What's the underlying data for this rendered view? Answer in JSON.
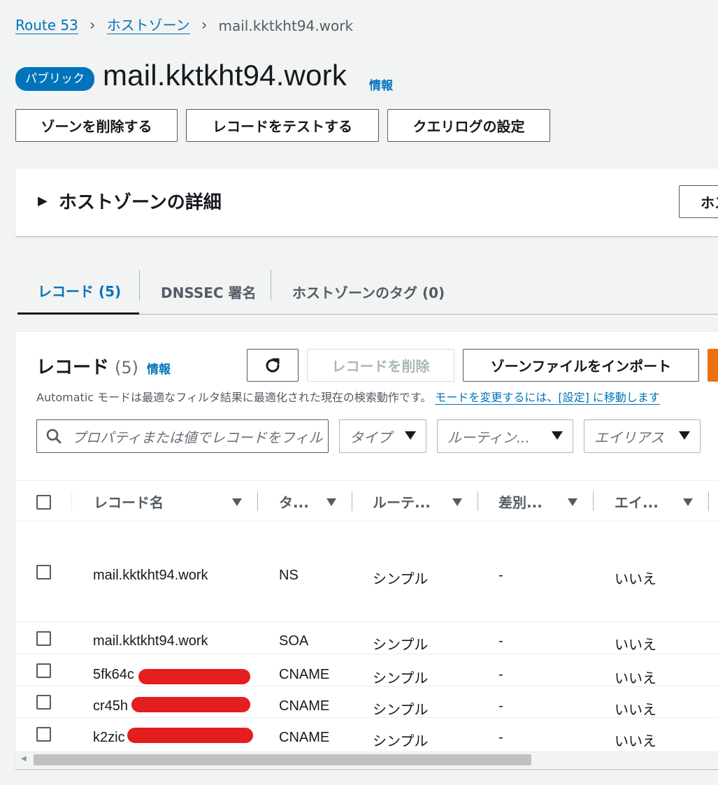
{
  "breadcrumb": {
    "root": "Route 53",
    "zones": "ホストゾーン",
    "current": "mail.kktkht94.work"
  },
  "header": {
    "badge": "パブリック",
    "title": "mail.kktkht94.work",
    "info": "情報"
  },
  "actions": {
    "delete_zone": "ゾーンを削除する",
    "test_record": "レコードをテストする",
    "query_log": "クエリログの設定"
  },
  "details_panel": {
    "title": "ホストゾーンの詳細",
    "button_partial": "ホス"
  },
  "tabs": [
    {
      "label": "レコード (5)"
    },
    {
      "label": "DNSSEC 署名"
    },
    {
      "label": "ホストゾーンのタグ (0)"
    }
  ],
  "records": {
    "title": "レコード",
    "count": "(5)",
    "info": "情報",
    "delete_label": "レコードを削除",
    "import_label": "ゾーンファイルをインポート",
    "hint": "Automatic モードは最適なフィルタ結果に最適化された現在の検索動作です。",
    "hint_link": "モードを変更するには、[設定] に移動します",
    "search_placeholder": "プロパティまたは値でレコードをフィルタリング",
    "filters": {
      "type": "タイプ",
      "routing": "ルーティン...",
      "alias": "エイリアス"
    },
    "columns": [
      "レコード名",
      "タ...",
      "ルーテ...",
      "差別...",
      "エイ..."
    ],
    "rows": [
      {
        "name": "mail.kktkht94.work",
        "type": "NS",
        "routing": "シンプル",
        "diff": "-",
        "alias": "いいえ"
      },
      {
        "name": "mail.kktkht94.work",
        "type": "SOA",
        "routing": "シンプル",
        "diff": "-",
        "alias": "いいえ"
      },
      {
        "name": "5fk64c",
        "type": "CNAME",
        "routing": "シンプル",
        "diff": "-",
        "alias": "いいえ"
      },
      {
        "name": "cr45h",
        "type": "CNAME",
        "routing": "シンプル",
        "diff": "-",
        "alias": "いいえ"
      },
      {
        "name": "k2zic",
        "type": "CNAME",
        "routing": "シンプル",
        "diff": "-",
        "alias": "いいえ"
      }
    ]
  },
  "colors": {
    "link": "#0073bb",
    "redaction": "#e41e1e",
    "primary": "#ec7211"
  }
}
